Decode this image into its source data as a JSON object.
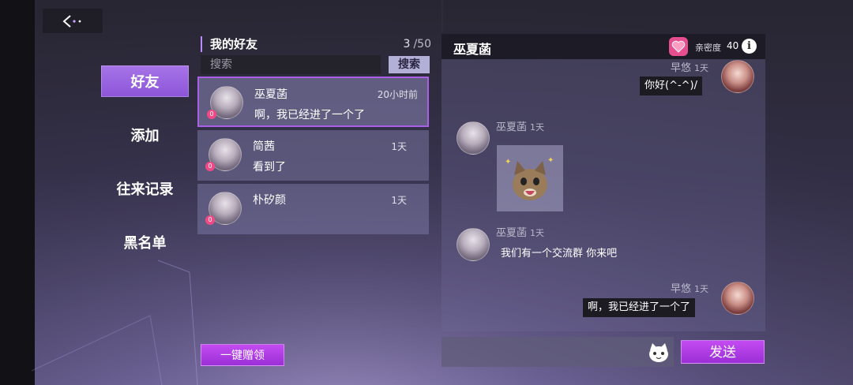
{
  "nav": {
    "back_label": "<",
    "items": [
      {
        "label": "好友"
      },
      {
        "label": "添加"
      },
      {
        "label": "往来记录"
      },
      {
        "label": "黑名单"
      }
    ]
  },
  "friends": {
    "title": "我的好友",
    "count": "3",
    "max": "/50",
    "search_placeholder": "搜索",
    "search_button": "搜索",
    "list": [
      {
        "name": "巫夏菡",
        "time": "20小时前",
        "message": "啊，我已经进了一个了",
        "badge": "0"
      },
      {
        "name": "简茜",
        "time": "1天",
        "message": "看到了",
        "badge": "0"
      },
      {
        "name": "朴矽颜",
        "time": "1天",
        "message": "",
        "badge": "0"
      }
    ],
    "bulk_claim_button": "一键赠领"
  },
  "chat": {
    "title": "巫夏菡",
    "intimacy_badge": "0",
    "intimacy_label": "亲密度",
    "intimacy_value": "40",
    "info_label": "i",
    "messages": [
      {
        "sender": "早悠",
        "time": "1天",
        "text": "你好(^-^)/"
      },
      {
        "sender": "巫夏菡",
        "time": "1天",
        "text": ""
      },
      {
        "sender": "巫夏菡",
        "time": "1天",
        "text": "我们有一个交流群 你来吧"
      },
      {
        "sender": "早悠",
        "time": "1天",
        "text": "啊，我已经进了一个了"
      }
    ],
    "send_button": "发送"
  },
  "colors": {
    "accent_purple": "#a861e6",
    "button_magenta": "#b43fe6",
    "heart_pink": "#f04a86"
  }
}
